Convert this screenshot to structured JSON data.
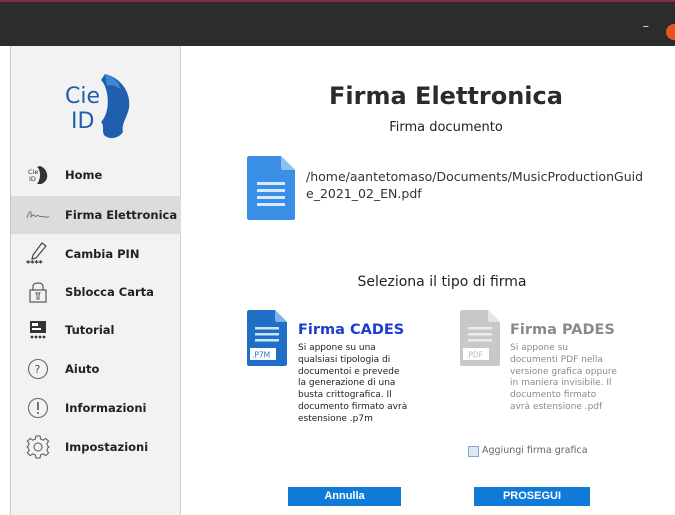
{
  "window": {
    "minimize_glyph": "–"
  },
  "sidebar": {
    "logo_text_top": "Cie",
    "logo_text_bottom": "ID",
    "items": [
      {
        "label": "Home",
        "icon": "cie-home-icon",
        "active": false
      },
      {
        "label": "Firma Elettronica",
        "icon": "signature-icon",
        "active": true
      },
      {
        "label": "Cambia PIN",
        "icon": "pin-pen-icon",
        "active": false
      },
      {
        "label": "Sblocca Carta",
        "icon": "padlock-icon",
        "active": false
      },
      {
        "label": "Tutorial",
        "icon": "tutorial-icon",
        "active": false
      },
      {
        "label": "Aiuto",
        "icon": "help-icon",
        "active": false
      },
      {
        "label": "Informazioni",
        "icon": "info-icon",
        "active": false
      },
      {
        "label": "Impostazioni",
        "icon": "gear-icon",
        "active": false
      }
    ]
  },
  "main": {
    "title": "Firma Elettronica",
    "subtitle": "Firma documento",
    "file_path": "/home/aantetomaso/Documents/MusicProductionGuide_2021_02_EN.pdf",
    "section_title": "Seleziona il tipo di firma",
    "options": [
      {
        "title": "Firma CADES",
        "badge": ".P7M",
        "description": "Si appone su una qualsiasi tipologia di documentoi e prevede la generazione di una busta crittografica. Il documento firmato avrà estensione .p7m",
        "selected": true
      },
      {
        "title": "Firma PADES",
        "badge": ".PDF",
        "description": "Si appone su documenti PDF nella versione grafica oppure in maniera invisibile. Il documento firmato avrà estensione .pdf",
        "selected": false
      }
    ],
    "checkbox_label": "Aggiungi firma grafica",
    "checkbox_checked": false,
    "cancel_label": "Annulla",
    "proceed_label": "PROSEGUI"
  },
  "colors": {
    "accent": "#0f7ad8",
    "selected_icon": "#1f6fc6",
    "disabled_icon": "#c8c8c8",
    "selected_title": "#1a3fd0",
    "disabled_title": "#8a8a8a"
  }
}
